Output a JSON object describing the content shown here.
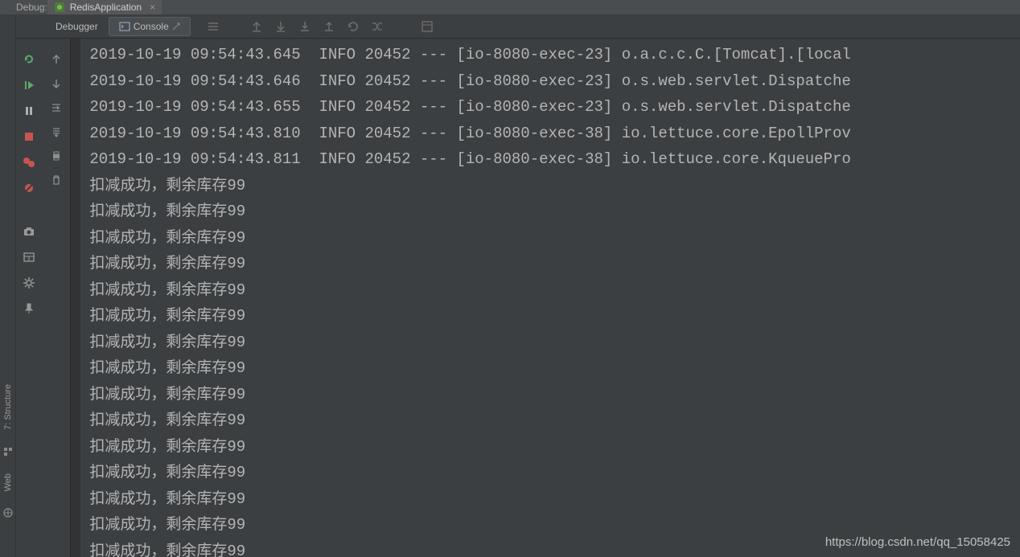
{
  "topbar": {
    "debug_label": "Debug:",
    "run_config": "RedisApplication",
    "close_x": "×"
  },
  "tabs": {
    "debugger": "Debugger",
    "console": "Console"
  },
  "left_labels": {
    "structure": "7: Structure",
    "web": "Web"
  },
  "console": {
    "lines": [
      "2019-10-19 09:54:43.645  INFO 20452 --- [io-8080-exec-23] o.a.c.c.C.[Tomcat].[local",
      "2019-10-19 09:54:43.646  INFO 20452 --- [io-8080-exec-23] o.s.web.servlet.Dispatche",
      "2019-10-19 09:54:43.655  INFO 20452 --- [io-8080-exec-23] o.s.web.servlet.Dispatche",
      "2019-10-19 09:54:43.810  INFO 20452 --- [io-8080-exec-38] io.lettuce.core.EpollProv",
      "2019-10-19 09:54:43.811  INFO 20452 --- [io-8080-exec-38] io.lettuce.core.KqueuePro",
      "扣减成功，剩余库存99",
      "扣减成功，剩余库存99",
      "扣减成功，剩余库存99",
      "扣减成功，剩余库存99",
      "扣减成功，剩余库存99",
      "扣减成功，剩余库存99",
      "扣减成功，剩余库存99",
      "扣减成功，剩余库存99",
      "扣减成功，剩余库存99",
      "扣减成功，剩余库存99",
      "扣减成功，剩余库存99",
      "扣减成功，剩余库存99",
      "扣减成功，剩余库存99",
      "扣减成功，剩余库存99",
      "扣减成功，剩余库存99"
    ]
  },
  "watermark": "https://blog.csdn.net/qq_15058425"
}
